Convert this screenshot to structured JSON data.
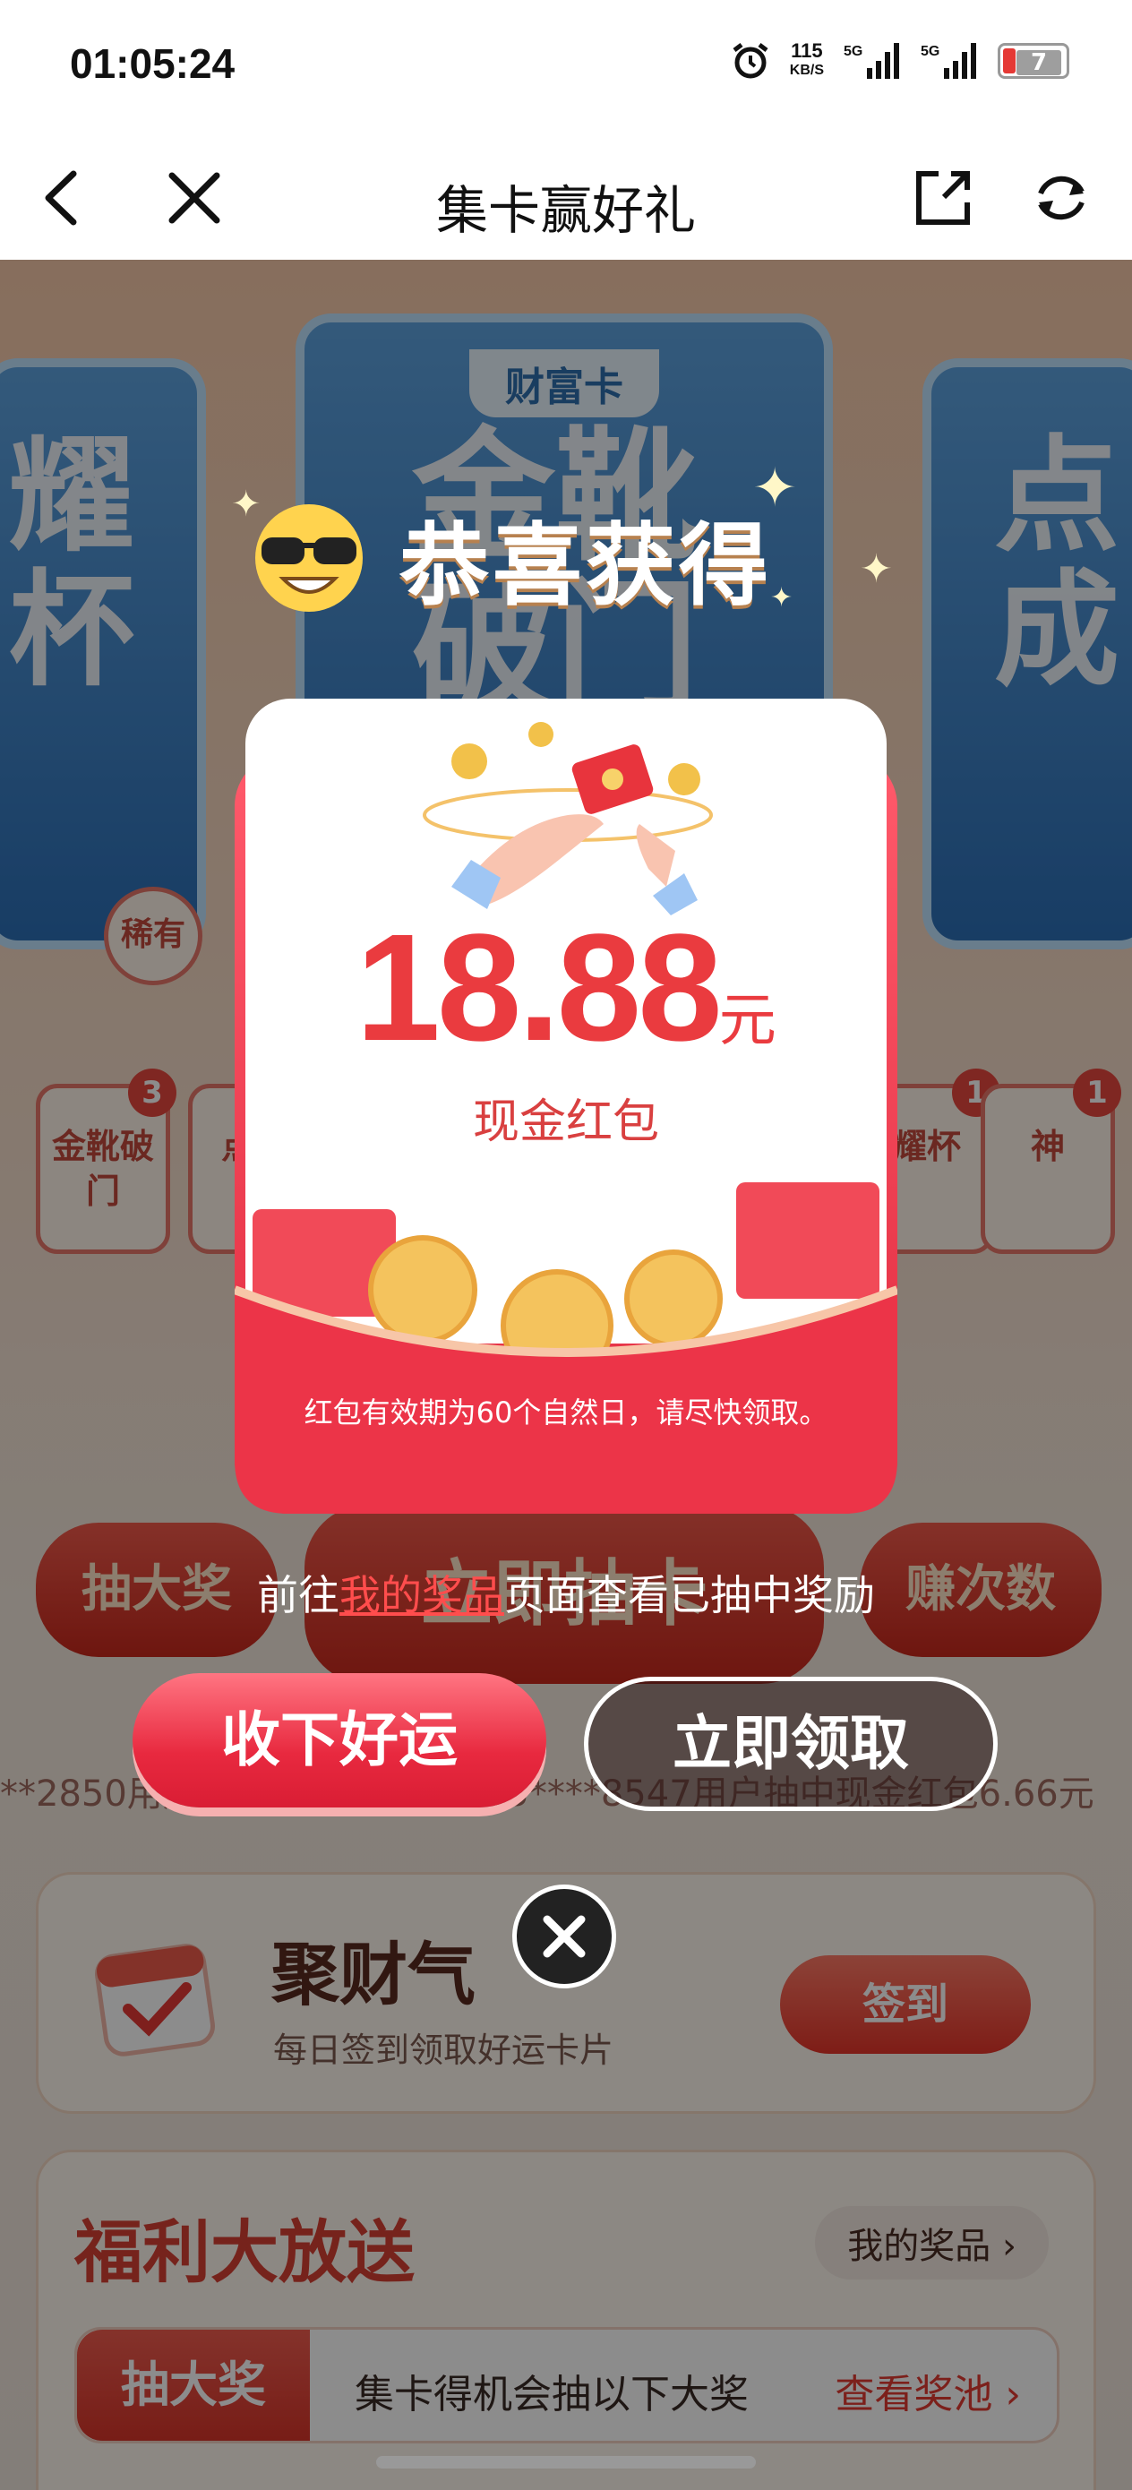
{
  "status_bar": {
    "time": "01:05:24",
    "net_speed": "115",
    "net_unit": "KB/S",
    "signal1": "5G",
    "signal2": "5G",
    "battery": "7"
  },
  "nav": {
    "title": "集卡赢好礼",
    "back_icon": "chevron-left-icon",
    "close_icon": "close-icon",
    "share_icon": "external-link-icon",
    "refresh_icon": "refresh-icon"
  },
  "background": {
    "cards": {
      "left_text": "耀杯",
      "left_sub": "稀有",
      "center_tag": "财富卡",
      "center_text": "金靴破门",
      "right_text": "点成"
    },
    "mini_cards": [
      {
        "label": "金靴破门",
        "count": "3"
      },
      {
        "label": "点成",
        "count": ""
      },
      {
        "label": "耀杯",
        "count": "1"
      },
      {
        "label": "神",
        "count": "1"
      }
    ],
    "left_button": "抽大奖",
    "center_button": "立即抽卡",
    "right_button": "赚次数",
    "ticker": "**2850用户抽中现金红包…  185****8547用户抽中现金红包6.66元",
    "checkin": {
      "title": "聚财气",
      "subtitle": "每日签到领取好运卡片",
      "button": "签到"
    },
    "welfare": {
      "title": "福利大放送",
      "my_prizes": "我的奖品 ›",
      "tab_label": "抽大奖",
      "tab_text": "集卡得机会抽以下大奖",
      "tab_link": "查看奖池 ›"
    }
  },
  "modal": {
    "heading": "恭喜获得",
    "amount": "18.88",
    "unit": "元",
    "label": "现金红包",
    "validity": "红包有效期为60个自然日，请尽快领取。",
    "notice_prefix": "前往",
    "notice_link": "我的奖品",
    "notice_suffix": "页面查看已抽中奖励",
    "accept_button": "收下好运",
    "claim_button": "立即领取",
    "colors": {
      "accent": "#ea3b3f",
      "envelope": "#e02a3e"
    }
  }
}
